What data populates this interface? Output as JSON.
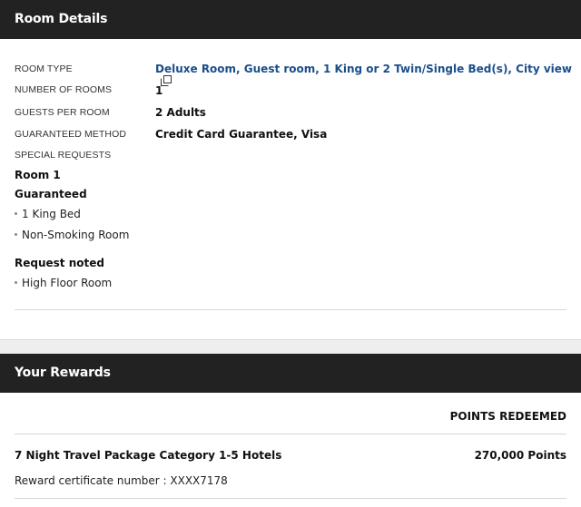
{
  "room_details": {
    "title": "Room Details",
    "room_type_label": "ROOM TYPE",
    "room_type_value": "Deluxe Room, Guest room, 1 King or 2 Twin/Single Bed(s), City view",
    "number_of_rooms_label": "NUMBER OF ROOMS",
    "number_of_rooms_value": "1",
    "guests_per_room_label": "GUESTS PER ROOM",
    "guests_per_room_value": "2 Adults",
    "guaranteed_method_label": "GUARANTEED METHOD",
    "guaranteed_method_value": "Credit Card Guarantee, Visa",
    "special_requests_label": "SPECIAL REQUESTS",
    "room_heading": "Room 1",
    "guaranteed_heading": "Guaranteed",
    "guaranteed_items": [
      "1 King Bed",
      "Non-Smoking Room"
    ],
    "noted_heading": "Request noted",
    "noted_items": [
      "High Floor Room"
    ]
  },
  "rewards": {
    "title": "Your Rewards",
    "points_header": "POINTS REDEEMED",
    "reward_name": "7 Night Travel Package Category 1-5 Hotels",
    "reward_points": "270,000 Points",
    "certificate_text": "Reward certificate number : XXXX7178"
  },
  "icons": {
    "external_link": "external-link-icon"
  },
  "colors": {
    "header_bg": "#222222",
    "link": "#1a4e8a"
  }
}
